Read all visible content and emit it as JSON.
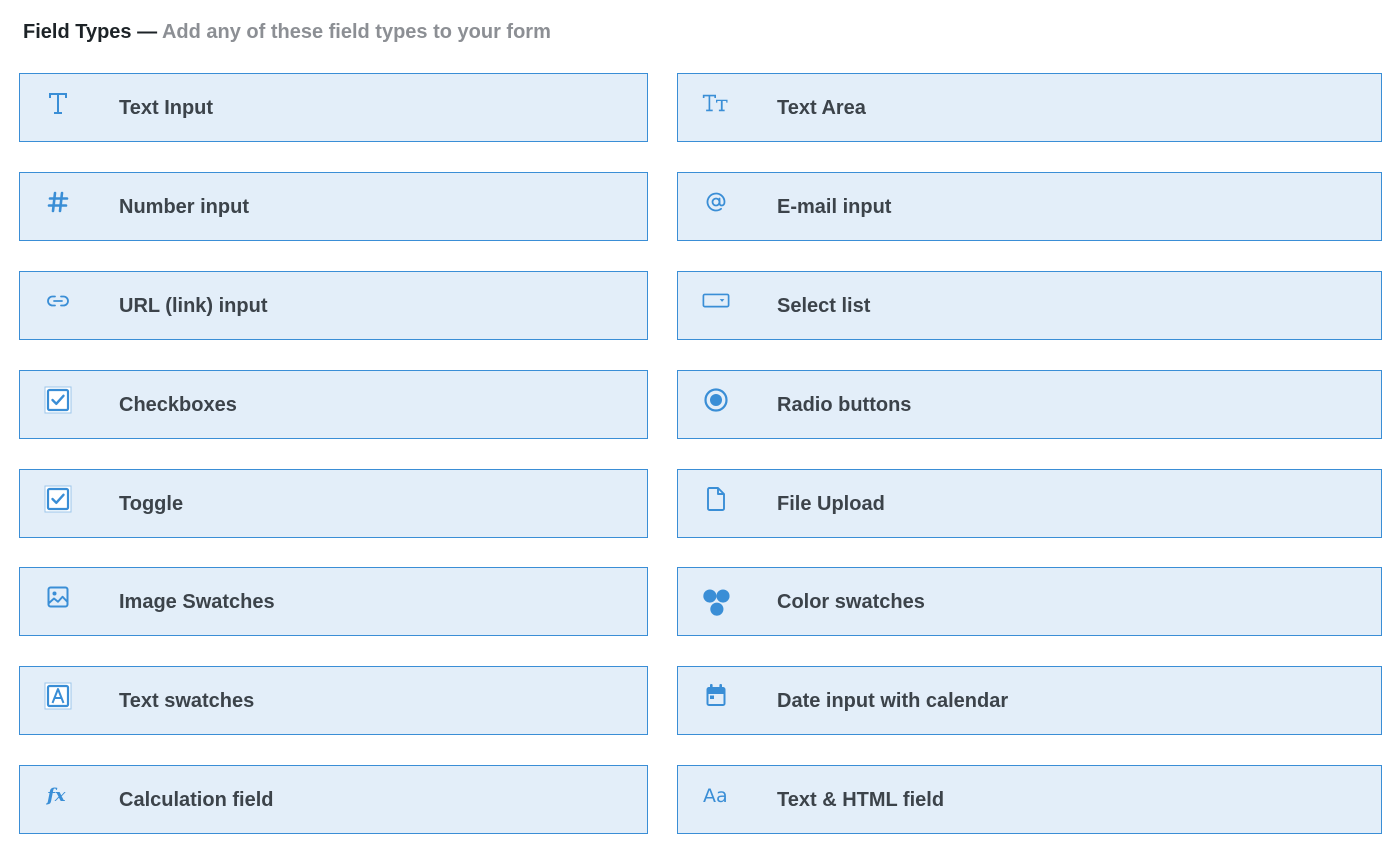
{
  "header": {
    "title": "Field Types",
    "separator": "—",
    "subtitle": "Add any of these field types to your form"
  },
  "accent_color": "#3a8ed6",
  "card_background": "#e3eef9",
  "fields": [
    {
      "label": "Text Input",
      "icon": "text-t-icon"
    },
    {
      "label": "Text Area",
      "icon": "text-size-icon"
    },
    {
      "label": "Number input",
      "icon": "hash-icon"
    },
    {
      "label": "E-mail input",
      "icon": "at-sign-icon"
    },
    {
      "label": "URL (link) input",
      "icon": "link-icon"
    },
    {
      "label": "Select list",
      "icon": "select-box-icon"
    },
    {
      "label": "Checkboxes",
      "icon": "checkbox-icon"
    },
    {
      "label": "Radio buttons",
      "icon": "radio-icon"
    },
    {
      "label": "Toggle",
      "icon": "checkbox-icon"
    },
    {
      "label": "File Upload",
      "icon": "file-icon"
    },
    {
      "label": "Image Swatches",
      "icon": "image-icon"
    },
    {
      "label": "Color swatches",
      "icon": "color-dots-icon"
    },
    {
      "label": "Text swatches",
      "icon": "letter-a-box-icon"
    },
    {
      "label": "Date input with calendar",
      "icon": "calendar-icon"
    },
    {
      "label": "Calculation field",
      "icon": "function-fx-icon"
    },
    {
      "label": "Text & HTML field",
      "icon": "typography-aa-icon"
    }
  ]
}
